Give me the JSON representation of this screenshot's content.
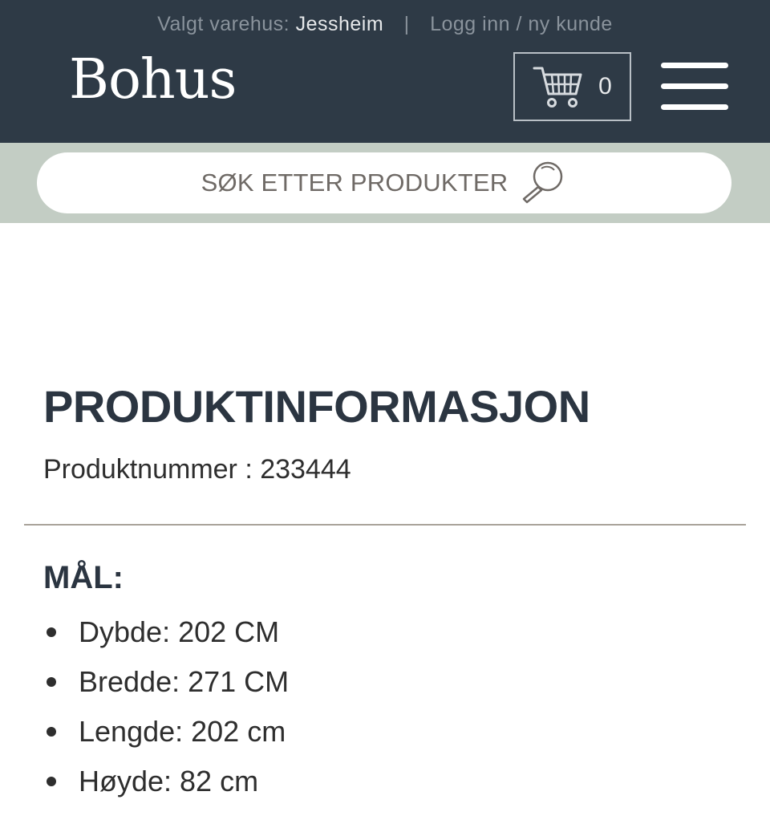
{
  "header": {
    "store_label": "Valgt varehus:",
    "store_name": "Jessheim",
    "separator": "|",
    "login_link": "Logg inn / ny kunde",
    "logo": "Bohus",
    "cart": {
      "icon": "cart-icon",
      "count": "0"
    },
    "menu_icon": "hamburger-menu-icon"
  },
  "search": {
    "placeholder": "SØK ETTER PRODUKTER",
    "icon": "search-icon"
  },
  "product": {
    "heading": "PRODUKTINFORMASJON",
    "number_text": "Produktnummer : 233444",
    "dimensions_heading": "MÅL:",
    "dimensions": [
      "Dybde: 202 CM",
      "Bredde: 271 CM",
      "Lengde: 202 cm",
      "Høyde: 82 cm"
    ]
  },
  "colors": {
    "header_bg": "#2e3a46",
    "search_band_bg": "#c3cdc4",
    "text_dark": "#2b3541"
  }
}
